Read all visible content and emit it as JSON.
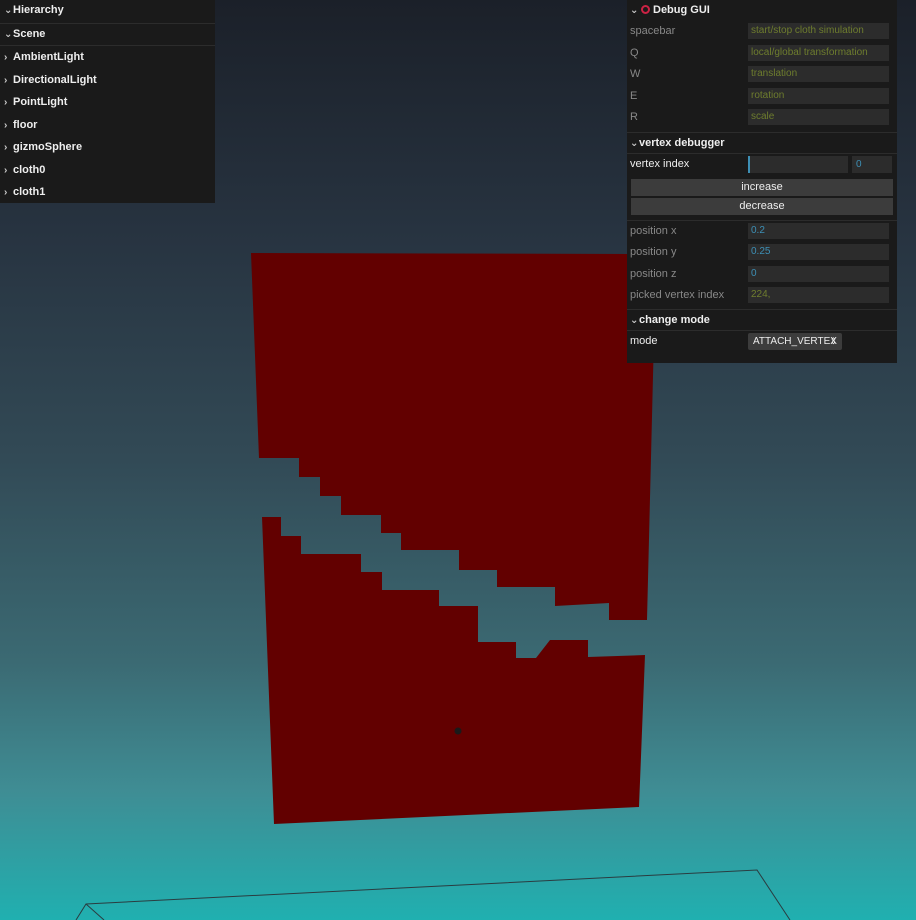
{
  "hierarchy": {
    "title": "Hierarchy",
    "scene": "Scene",
    "items": [
      "AmbientLight",
      "DirectionalLight",
      "PointLight",
      "floor",
      "gizmoSphere",
      "cloth0",
      "cloth1"
    ]
  },
  "gui": {
    "title": "Debug GUI",
    "keys": [
      {
        "key": "spacebar",
        "action": "start/stop cloth simulation"
      },
      {
        "key": "Q",
        "action": "local/global transformation"
      },
      {
        "key": "W",
        "action": "translation"
      },
      {
        "key": "E",
        "action": "rotation"
      },
      {
        "key": "R",
        "action": "scale"
      }
    ],
    "vertex_debugger": {
      "title": "vertex debugger",
      "index_label": "vertex index",
      "index_value": "0",
      "increase_label": "increase",
      "decrease_label": "decrease",
      "position_x_label": "position x",
      "position_x": "0.2",
      "position_y_label": "position y",
      "position_y": "0.25",
      "position_z_label": "position z",
      "position_z": "0",
      "picked_label": "picked vertex index",
      "picked_value": "224,"
    },
    "change_mode": {
      "title": "change mode",
      "mode_label": "mode",
      "mode_value": "ATTACH_VERTEX"
    }
  },
  "colors": {
    "cloth": "#620000",
    "panel": "#1a1a1a",
    "string_value": "#6e7d2e",
    "number_value": "#3d8fb5"
  }
}
